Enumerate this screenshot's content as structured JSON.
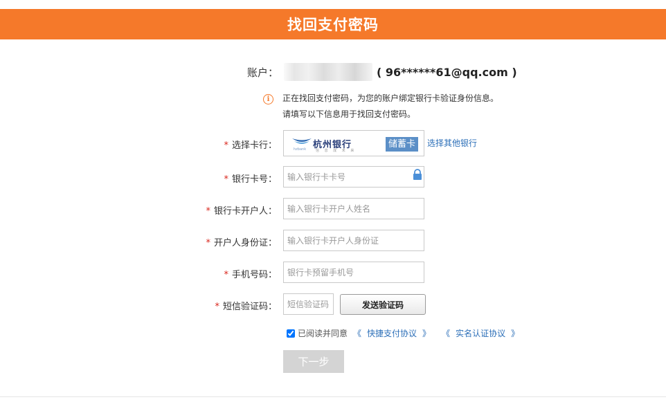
{
  "header": {
    "title": "找回支付密码"
  },
  "account": {
    "label": "账户：",
    "email_display": "( 96******61@qq.com )"
  },
  "notice": {
    "icon": "info-icon",
    "line1": "正在找回支付密码，为您的账户绑定银行卡验证身份信息。",
    "line2": "请填写以下信息用于找回支付密码。"
  },
  "form": {
    "bank": {
      "label": "选择卡行：",
      "bank_name": "杭州银行",
      "bank_sub": "hzbank",
      "bank_slogan": "信 息 成 未 来",
      "card_type": "储蓄卡",
      "other_link": "选择其他银行"
    },
    "card_number": {
      "label": "银行卡号：",
      "placeholder": "输入银行卡卡号"
    },
    "holder_name": {
      "label": "银行卡开户人：",
      "placeholder": "输入银行卡开户人姓名"
    },
    "holder_id": {
      "label": "开户人身份证：",
      "placeholder": "输入银行卡开户人身份证"
    },
    "phone": {
      "label": "手机号码：",
      "placeholder": "银行卡预留手机号"
    },
    "sms_code": {
      "label": "短信验证码：",
      "placeholder": "短信验证码",
      "send_button": "发送验证码"
    },
    "required_mark": "*"
  },
  "agreement": {
    "prefix": "已阅读并同意",
    "open_bracket": "《",
    "close_bracket": "》",
    "link1": "快捷支付协议",
    "link2": "实名认证协议"
  },
  "next_button": "下一步",
  "colors": {
    "accent": "#f5792a",
    "link": "#2c6fb8",
    "required": "#d9261c",
    "disabled_button": "#d4d4d4"
  }
}
